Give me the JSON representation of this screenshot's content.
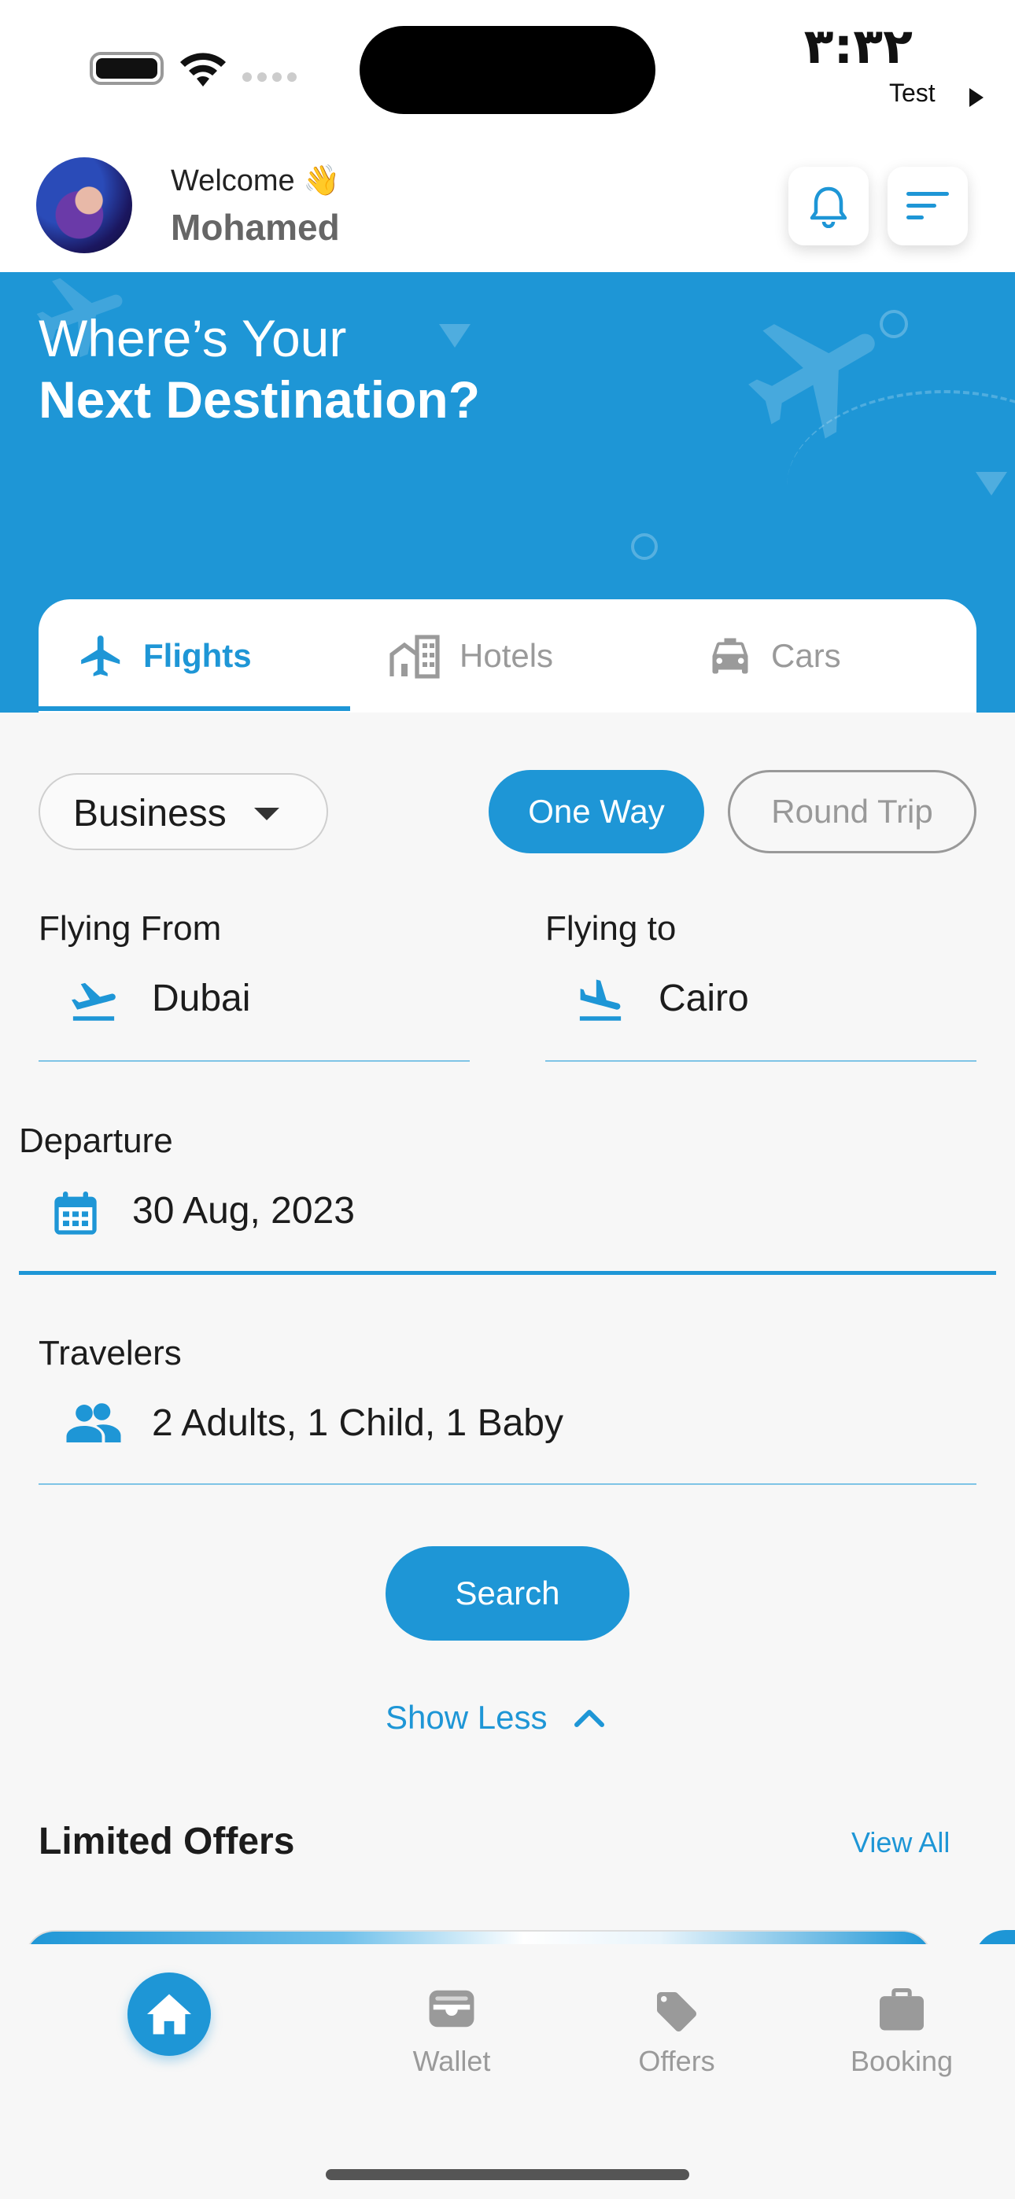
{
  "status_bar": {
    "time": "٣:٣٢",
    "carrier": "Test"
  },
  "header": {
    "welcome": "Welcome 👋",
    "user_name": "Mohamed"
  },
  "hero": {
    "line1": "Where’s Your",
    "line2": "Next Destination?"
  },
  "tabs": [
    {
      "label": "Flights",
      "icon": "plane-icon",
      "active": true
    },
    {
      "label": "Hotels",
      "icon": "hotel-icon",
      "active": false
    },
    {
      "label": "Cars",
      "icon": "car-icon",
      "active": false
    }
  ],
  "form": {
    "cabin_class": "Business",
    "trip_types": [
      {
        "label": "One Way",
        "selected": true
      },
      {
        "label": "Round Trip",
        "selected": false
      }
    ],
    "from_label": "Flying From",
    "from_value": "Dubai",
    "to_label": "Flying to",
    "to_value": "Cairo",
    "departure_label": "Departure",
    "departure_value": "30 Aug, 2023",
    "travelers_label": "Travelers",
    "travelers_value": "2 Adults, 1 Child, 1 Baby",
    "search_label": "Search",
    "show_less_label": "Show Less"
  },
  "offers": {
    "title": "Limited Offers",
    "view_all": "View All"
  },
  "bottom_nav": [
    {
      "label": "",
      "icon": "home-icon",
      "active": true
    },
    {
      "label": "Wallet",
      "icon": "wallet-icon",
      "active": false
    },
    {
      "label": "Offers",
      "icon": "tag-icon",
      "active": false
    },
    {
      "label": "Booking",
      "icon": "briefcase-icon",
      "active": false
    }
  ],
  "colors": {
    "primary": "#1e96d6",
    "inactive": "#9a9a9a",
    "background": "#f7f7f7"
  }
}
